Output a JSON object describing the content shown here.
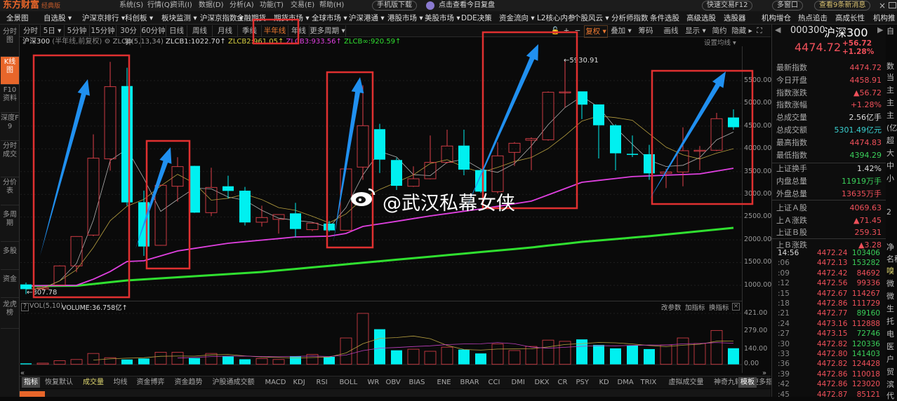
{
  "app": {
    "logo": "东方财富",
    "edition": "经典版"
  },
  "menu": [
    "系统(S)",
    "行情(Q)",
    "资讯(I)",
    "数据(D)",
    "分析(A)",
    "功能(T)",
    "交易(E)",
    "帮助(H)"
  ],
  "title_actions": {
    "mobile": "手机版下载",
    "review": "点击查看今日复盘",
    "quick_trade": "快速交易F12",
    "multi_window": "多窗口",
    "messages": "查看9条新消息",
    "close": "×"
  },
  "nav": [
    "全景图",
    "自选股 ▾",
    "沪深京排行 ▾",
    "科创板 ▾",
    "板块监测 ▾",
    "沪深京指数 ▾",
    "金融期货",
    "期货市场 ▾",
    "全球市场 ▾",
    "沪深港通 ▾",
    "港股市场 ▾",
    "美股市场 ▾",
    "DDE决策",
    "资金流向 ▾",
    "L2核心内参",
    "个股风云 ▾",
    "分析师指数",
    "条件选股",
    "高级选股",
    "选股器",
    "机构增仓",
    "热点追击",
    "高成长性",
    "机构推荐"
  ],
  "sidebar": [
    "分时图",
    "K线图",
    "F10资料",
    "深度F9",
    "分时成交",
    "分价表",
    "多周期",
    "多股",
    "资金",
    "龙虎榜"
  ],
  "periods": [
    "分时",
    "5日 ▾",
    "5分钟",
    "15分钟",
    "30分钟",
    "60分钟",
    "日线",
    "周线",
    "月线",
    "季线",
    "半年线",
    "年线",
    "更多周期 ▾"
  ],
  "active_period": "半年线",
  "tools": [
    "🔓",
    "+",
    "−",
    "复权 ▾",
    "叠加 ▾",
    "筹码",
    "画线",
    "显示 ▾",
    "简约",
    "隐藏 ▸",
    "⛶"
  ],
  "info": {
    "name": "沪深300",
    "mode": "(半年线,前复权)",
    "indicator": "ZLCB(5,13,34)",
    "zlcb1": "ZLCB1:1022.70↑",
    "zlcb2": "ZLCB2:961.05↑",
    "zlcb3": "ZLCB3:933.56↑",
    "zlcbinf": "ZLCB∞:920.59↑",
    "set_ma": "设置均线 ▾"
  },
  "price_axis": [
    "5500.00",
    "5000.00",
    "4500.00",
    "4000.00",
    "3500.00",
    "3000.00",
    "2500.00",
    "2000.00",
    "1500.00",
    "1000.00"
  ],
  "labels": {
    "low": "←807.78",
    "high": "←5930.91"
  },
  "watermark": "@武汉私幕女侠",
  "colors": {
    "up": "#e0404a",
    "down": "#00f0f0",
    "ma_fast": "#b0b0b0",
    "ma_slow": "#b8a040",
    "zlcb3": "#e040e0",
    "zlcbinf": "#30e030",
    "annot_box": "#e03030",
    "annot_arrow": "#2090f0"
  },
  "chart_data": {
    "type": "candlestick",
    "title": "沪深300 半年线",
    "ylim": [
      800,
      6000
    ],
    "candles": [
      [
        1020,
        917,
        1060,
        807.78
      ],
      [
        920,
        950,
        980,
        890
      ],
      [
        1005,
        1427,
        1440,
        1000
      ],
      [
        1427,
        2074,
        2080,
        1288
      ],
      [
        2105,
        3794,
        4318,
        2080
      ],
      [
        3779,
        5366,
        5911,
        3522
      ],
      [
        5380,
        2823,
        5782,
        2751
      ],
      [
        2828,
        1853,
        3082,
        1648
      ],
      [
        1879,
        3199,
        3210,
        1870
      ],
      [
        3177,
        3609,
        3815,
        2839
      ],
      [
        3625,
        2598,
        3630,
        2590
      ],
      [
        2598,
        3152,
        3584,
        2521
      ],
      [
        3177,
        3075,
        3409,
        2906
      ],
      [
        3080,
        2382,
        3162,
        2315
      ],
      [
        2387,
        2490,
        2751,
        2290
      ],
      [
        2450,
        2556,
        2556,
        2136
      ],
      [
        2582,
        2238,
        2813,
        2059
      ],
      [
        2223,
        2367,
        2380,
        2190
      ],
      [
        2357,
        2208,
        2418,
        2180
      ],
      [
        2208,
        3558,
        3570,
        2200
      ],
      [
        3599,
        4509,
        5397,
        3318
      ],
      [
        4432,
        3763,
        4549,
        3470
      ],
      [
        3754,
        3188,
        3800,
        3095
      ],
      [
        3177,
        3342,
        3615,
        3162
      ],
      [
        3342,
        3702,
        4293,
        3330
      ],
      [
        3702,
        4062,
        4420,
        3680
      ],
      [
        4071,
        3543,
        4420,
        3419
      ],
      [
        3533,
        3060,
        3560,
        3030
      ],
      [
        3060,
        3846,
        4148,
        3020
      ],
      [
        3923,
        4123,
        4150,
        3625
      ],
      [
        4190,
        4225,
        4251,
        3531
      ],
      [
        4200,
        5243,
        5260,
        4180
      ],
      [
        5243,
        5253,
        5930.91,
        4909
      ],
      [
        5263,
        4971,
        5263,
        4654
      ],
      [
        4976,
        4518,
        4976,
        3789
      ],
      [
        4518,
        3902,
        4540,
        3527
      ],
      [
        3890,
        3880,
        4293,
        3820
      ],
      [
        3882,
        3461,
        4087,
        3318
      ],
      [
        3461,
        3492,
        3560,
        3137
      ],
      [
        3492,
        3959,
        4472,
        3177
      ],
      [
        3959,
        3969,
        4062,
        3530
      ],
      [
        3969,
        4663,
        4791,
        3950
      ],
      [
        4689,
        4475,
        4868,
        4421
      ]
    ],
    "candle_fields": [
      "open",
      "close",
      "high",
      "low"
    ],
    "zlcb3_points": [
      [
        0,
        990
      ],
      [
        3,
        1000
      ],
      [
        4.6,
        1215
      ],
      [
        6,
        1524
      ],
      [
        7,
        1540
      ],
      [
        9,
        1755
      ],
      [
        12,
        1925
      ],
      [
        16,
        2063
      ],
      [
        18,
        2080
      ],
      [
        19,
        2140
      ],
      [
        20,
        2295
      ],
      [
        21.4,
        2372
      ],
      [
        24,
        2525
      ],
      [
        27,
        2680
      ],
      [
        30,
        2850
      ],
      [
        33,
        3265
      ],
      [
        36,
        3390
      ],
      [
        40,
        3450
      ],
      [
        42,
        3573
      ]
    ],
    "zlcbinf_points": [
      [
        0,
        985
      ],
      [
        3,
        990
      ],
      [
        6,
        1108
      ],
      [
        14,
        1293
      ],
      [
        21,
        1530
      ],
      [
        30,
        1832
      ],
      [
        33,
        1955
      ],
      [
        37,
        2080
      ],
      [
        42,
        2264
      ]
    ],
    "volume": {
      "label": "VOL(5,10)",
      "value_label": "VOLUME:36.758亿↑",
      "ylim": [
        0,
        421
      ],
      "values": [
        8,
        10,
        30,
        40,
        90,
        55,
        40,
        48,
        100,
        100,
        52,
        90,
        65,
        42,
        48,
        40,
        68,
        82,
        62,
        218,
        421,
        290,
        116,
        125,
        108,
        142,
        122,
        90,
        168,
        114,
        148,
        200,
        190,
        206,
        160,
        132,
        155,
        126,
        160,
        218,
        172,
        280,
        133
      ]
    },
    "volume_axis": [
      "421.00",
      "279.00",
      "140.00",
      "0.00"
    ]
  },
  "vol_actions": [
    "改参数",
    "加指标",
    "换指标"
  ],
  "indicator_tabs": [
    "指标",
    "恢复默认",
    "成交量",
    "均线",
    "资金博弈",
    "资金趋势",
    "沪股通成交额",
    "MACD",
    "KDJ",
    "RSI",
    "BOLL",
    "WR",
    "OBV",
    "BIAS",
    "ENE",
    "BRAR",
    "CCI",
    "DMI",
    "DKX",
    "CR",
    "PSY",
    "KD",
    "DMA",
    "TRIX",
    "虚拟成交量",
    "神奇九转",
    "更多指标",
    "模板"
  ],
  "quote": {
    "code": "000300",
    "name": "沪深300",
    "price": "4474.72",
    "change": "+56.72",
    "pct": "+1.28%"
  },
  "stats": [
    {
      "k": "最新指数",
      "v": "4474.72",
      "c": "red"
    },
    {
      "k": "今日开盘",
      "v": "4458.91",
      "c": "red"
    },
    {
      "k": "指数涨跌",
      "v": "▲56.72",
      "c": "red"
    },
    {
      "k": "指数涨幅",
      "v": "+1.28%",
      "c": "red"
    },
    {
      "k": "总成交量",
      "v": "2.56亿手",
      "c": "wht"
    },
    {
      "k": "总成交额",
      "v": "5301.49亿元",
      "c": "cyn"
    },
    {
      "k": "最高指数",
      "v": "4474.83",
      "c": "red"
    },
    {
      "k": "最低指数",
      "v": "4394.29",
      "c": "grn"
    },
    {
      "k": "上证换手",
      "v": "1.42%",
      "c": "wht"
    },
    {
      "k": "内盘总量",
      "v": "11919万手",
      "c": "grn"
    },
    {
      "k": "外盘总量",
      "v": "13635万手",
      "c": "red"
    },
    {
      "k": "上证Ａ股",
      "v": "4069.63",
      "c": "red"
    },
    {
      "k": "上Ａ涨跌",
      "v": "▲71.45",
      "c": "red"
    },
    {
      "k": "上证Ｂ股",
      "v": "259.31",
      "c": "red"
    },
    {
      "k": "上Ｂ涨跌",
      "v": "▲3.28",
      "c": "red"
    }
  ],
  "ticks": [
    {
      "t": "14:56",
      "p": "4472.24",
      "v": "103406",
      "c": "grn"
    },
    {
      "t": ":06",
      "p": "4472.13",
      "v": "153282",
      "c": "grn"
    },
    {
      "t": ":09",
      "p": "4472.42",
      "v": "84692",
      "c": "red"
    },
    {
      "t": ":12",
      "p": "4472.56",
      "v": "99336",
      "c": "red"
    },
    {
      "t": ":15",
      "p": "4472.67",
      "v": "114267",
      "c": "red"
    },
    {
      "t": ":18",
      "p": "4472.86",
      "v": "111729",
      "c": "red"
    },
    {
      "t": ":21",
      "p": "4472.77",
      "v": "89160",
      "c": "grn"
    },
    {
      "t": ":24",
      "p": "4473.16",
      "v": "112888",
      "c": "red"
    },
    {
      "t": ":27",
      "p": "4473.15",
      "v": "72746",
      "c": "grn"
    },
    {
      "t": ":30",
      "p": "4472.82",
      "v": "120336",
      "c": "grn"
    },
    {
      "t": ":33",
      "p": "4472.80",
      "v": "141403",
      "c": "grn"
    },
    {
      "t": ":36",
      "p": "4472.82",
      "v": "124428",
      "c": "red"
    },
    {
      "t": ":39",
      "p": "4472.86",
      "v": "110018",
      "c": "red"
    },
    {
      "t": ":42",
      "p": "4472.86",
      "v": "123020",
      "c": "red"
    },
    {
      "t": ":45",
      "p": "4472.87",
      "v": "85121",
      "c": "red"
    }
  ],
  "cut_column": [
    "自",
    "数",
    "当",
    "主",
    "主",
    "主",
    "(亿",
    "超",
    "大",
    "中",
    "小",
    "2",
    "净",
    "名称",
    "嗅",
    "微",
    "微",
    "生",
    "托",
    "电",
    "医",
    "户",
    "贸",
    "滨",
    "代"
  ]
}
